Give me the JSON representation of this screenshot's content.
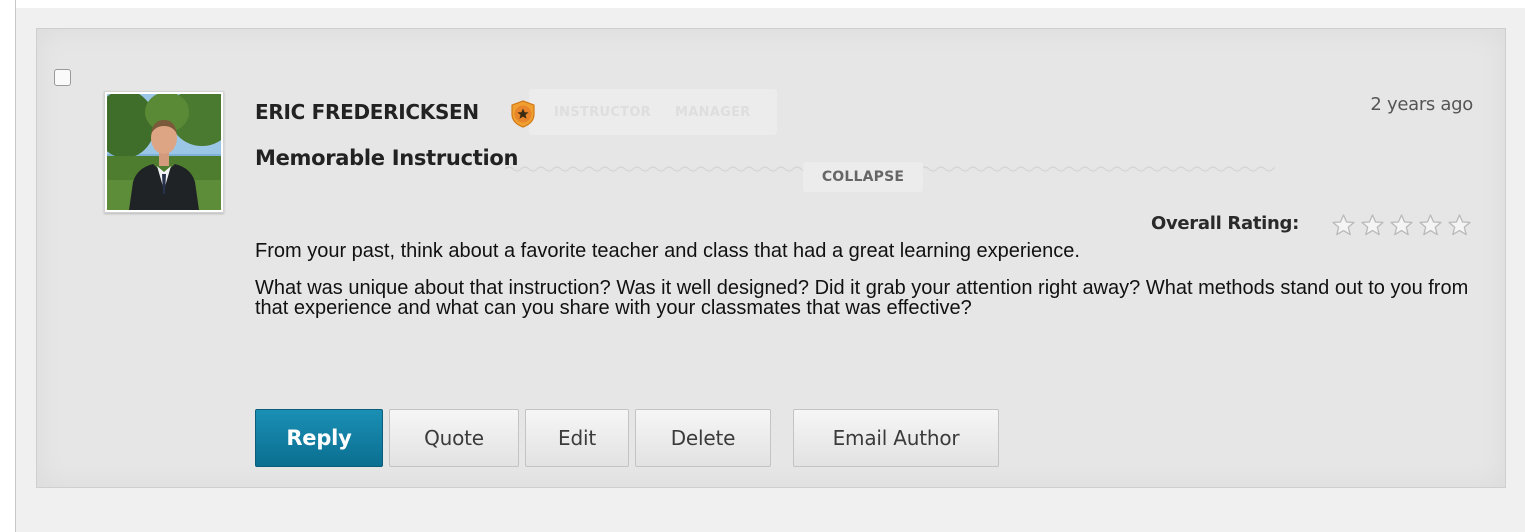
{
  "post": {
    "author_name": "ERIC FREDERICKSEN",
    "roles": [
      "INSTRUCTOR",
      "MANAGER"
    ],
    "title": "Memorable Instruction",
    "timestamp": "2 years ago",
    "collapse_label": "COLLAPSE",
    "rating_label": "Overall Rating:",
    "rating_value": 0,
    "rating_max": 5,
    "body": [
      "From your past, think about a favorite teacher and class that had a great learning experience.",
      "What was unique about that instruction? Was it well designed? Did it grab your attention right away? What methods stand out to you from that experience and what can you share with your classmates that was effective?"
    ],
    "selected": false
  },
  "actions": {
    "reply_label": "Reply",
    "quote_label": "Quote",
    "edit_label": "Edit",
    "delete_label": "Delete",
    "email_label": "Email Author"
  },
  "colors": {
    "primary_button": "#0e7ea3",
    "card_background": "#e6e6e6",
    "badge_orange": "#e8882a"
  },
  "icons": {
    "role_badge": "star-badge-icon",
    "rating_star": "star-outline-icon"
  }
}
